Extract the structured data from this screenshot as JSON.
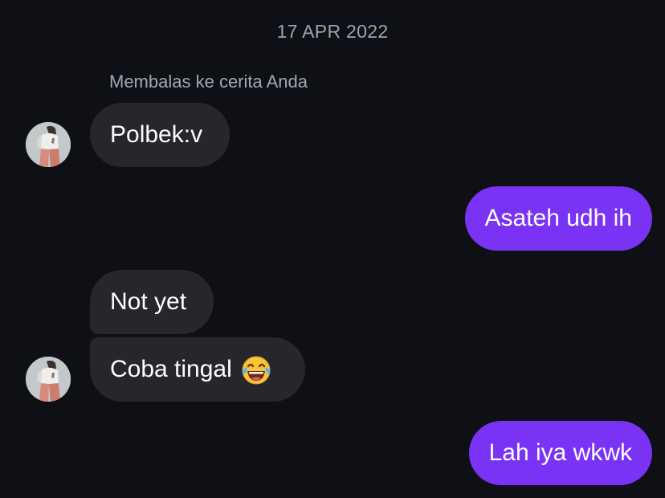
{
  "chat": {
    "date_separator": "17 APR 2022",
    "reply_note": "Membalas ke cerita Anda",
    "messages": [
      {
        "direction": "incoming",
        "text": "Polbek:v"
      },
      {
        "direction": "outgoing",
        "text": "Asateh udh ih"
      },
      {
        "direction": "incoming",
        "text": "Not yet"
      },
      {
        "direction": "incoming",
        "text": "Coba tingal",
        "emoji": "face-with-tears-of-joy-icon"
      },
      {
        "direction": "outgoing",
        "text": "Lah iya wkwk"
      }
    ]
  },
  "colors": {
    "background": "#0f1015",
    "incoming_bubble": "#25272c",
    "outgoing_bubble": "#7a33f5",
    "muted_text": "#9ea3ad"
  }
}
